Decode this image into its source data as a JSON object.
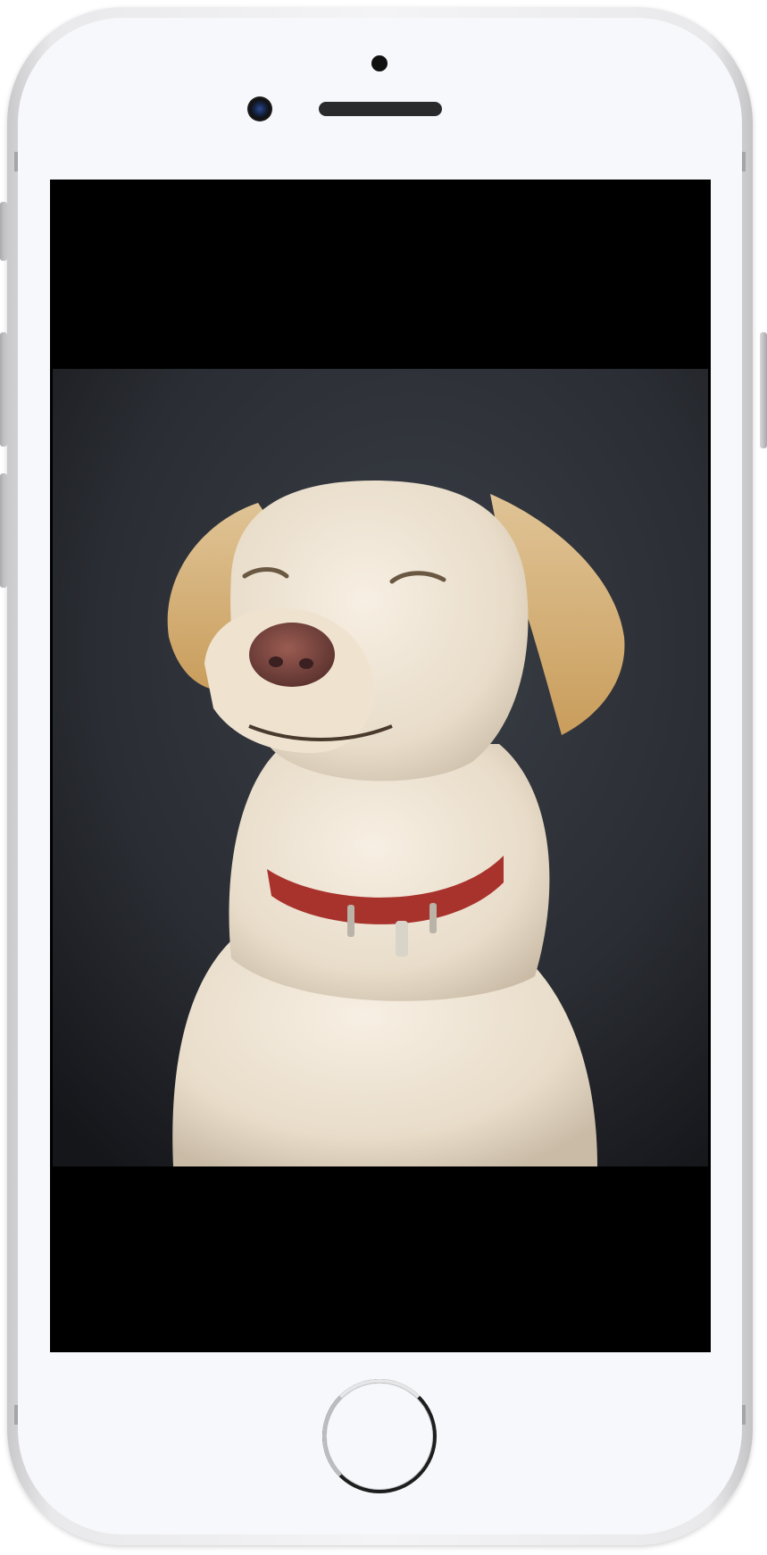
{
  "device": {
    "model": "iPhone",
    "frame_color": "#f4f4f6",
    "screen_bg": "#000000"
  },
  "screen": {
    "content_type": "photo",
    "photo_icon": "dog-photo",
    "colors": {
      "background": "#2d3036",
      "fur": "#efe4d2",
      "ear": "#d6b57f",
      "nose": "#7e4a42",
      "collar": "#a8322c"
    }
  },
  "hardware": {
    "home_button_icon": "home-button",
    "camera_icon": "front-camera-icon",
    "speaker_icon": "earpiece-speaker-icon",
    "sensor_icon": "proximity-sensor-icon"
  }
}
